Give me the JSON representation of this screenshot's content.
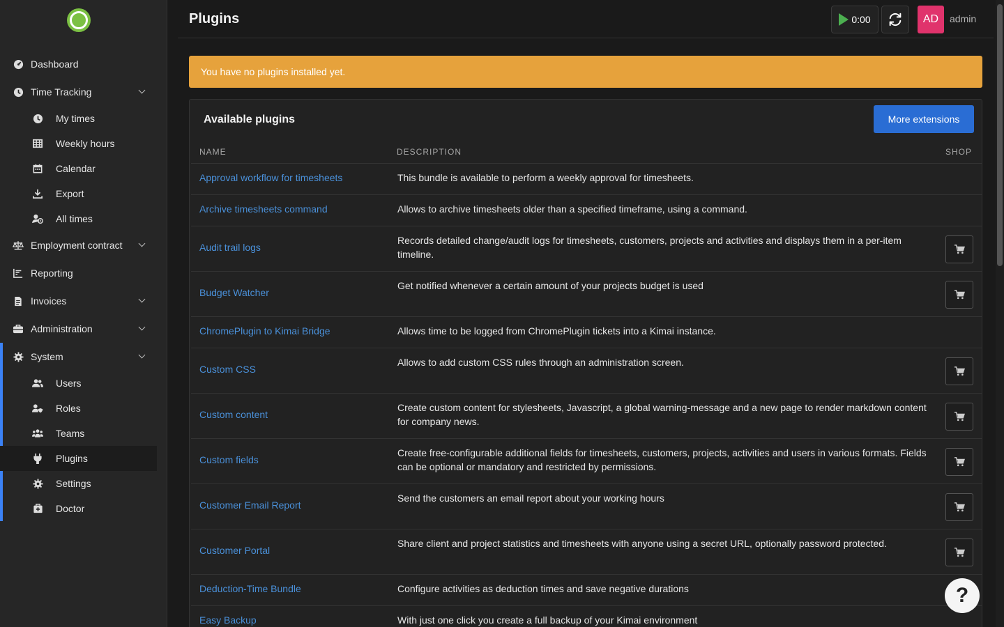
{
  "app": {
    "title": "Plugins",
    "accent": "#2a6dd4"
  },
  "sidebar": {
    "items": [
      {
        "label": "Dashboard",
        "icon": "dashboard-icon"
      },
      {
        "label": "Time Tracking",
        "icon": "clock-icon",
        "expandable": true
      },
      {
        "label": "My times",
        "icon": "clock-icon",
        "sub": true
      },
      {
        "label": "Weekly hours",
        "icon": "table-icon",
        "sub": true
      },
      {
        "label": "Calendar",
        "icon": "calendar-icon",
        "sub": true
      },
      {
        "label": "Export",
        "icon": "download-icon",
        "sub": true
      },
      {
        "label": "All times",
        "icon": "user-clock-icon",
        "sub": true
      },
      {
        "label": "Employment contract",
        "icon": "balance-scale-icon",
        "expandable": true
      },
      {
        "label": "Reporting",
        "icon": "chart-icon"
      },
      {
        "label": "Invoices",
        "icon": "invoice-icon",
        "expandable": true
      },
      {
        "label": "Administration",
        "icon": "toolbox-icon",
        "expandable": true
      },
      {
        "label": "System",
        "icon": "gear-icon",
        "expandable": true
      },
      {
        "label": "Users",
        "icon": "users-icon",
        "sub": true
      },
      {
        "label": "Roles",
        "icon": "user-shield-icon",
        "sub": true
      },
      {
        "label": "Teams",
        "icon": "team-icon",
        "sub": true
      },
      {
        "label": "Plugins",
        "icon": "plug-icon",
        "sub": true,
        "active": true
      },
      {
        "label": "Settings",
        "icon": "gear-icon",
        "sub": true
      },
      {
        "label": "Doctor",
        "icon": "medkit-icon",
        "sub": true
      }
    ]
  },
  "header": {
    "title": "Plugins",
    "timer": "0:00",
    "avatar": "AD",
    "username": "admin"
  },
  "alert": {
    "text": "You have no plugins installed yet."
  },
  "plugins": {
    "title": "Available plugins",
    "more_label": "More extensions",
    "columns": {
      "name": "NAME",
      "description": "DESCRIPTION",
      "shop": "SHOP"
    },
    "rows": [
      {
        "name": "Approval workflow for timesheets",
        "desc": "This bundle is available to perform a weekly approval for timesheets.",
        "shop": false
      },
      {
        "name": "Archive timesheets command",
        "desc": "Allows to archive timesheets older than a specified timeframe, using a command.",
        "shop": false
      },
      {
        "name": "Audit trail logs",
        "desc": "Records detailed change/audit logs for timesheets, customers, projects and activities and displays them in a per-item timeline.",
        "shop": true
      },
      {
        "name": "Budget Watcher",
        "desc": "Get notified whenever a certain amount of your projects budget is used",
        "shop": true
      },
      {
        "name": "ChromePlugin to Kimai Bridge",
        "desc": "Allows time to be logged from ChromePlugin tickets into a Kimai instance.",
        "shop": false
      },
      {
        "name": "Custom CSS",
        "desc": "Allows to add custom CSS rules through an administration screen.",
        "shop": true
      },
      {
        "name": "Custom content",
        "desc": "Create custom content for stylesheets, Javascript, a global warning-message and a new page to render markdown content for company news.",
        "shop": true
      },
      {
        "name": "Custom fields",
        "desc": "Create free-configurable additional fields for timesheets, customers, projects, activities and users in various formats. Fields can be optional or mandatory and restricted by permissions.",
        "shop": true
      },
      {
        "name": "Customer Email Report",
        "desc": "Send the customers an email report about your working hours",
        "shop": true
      },
      {
        "name": "Customer Portal",
        "desc": "Share client and project statistics and timesheets with anyone using a secret URL, optionally password protected.",
        "shop": true
      },
      {
        "name": "Deduction-Time Bundle",
        "desc": "Configure activities as deduction times and save negative durations",
        "shop": false
      },
      {
        "name": "Easy Backup",
        "desc": "With just one click you create a full backup of your Kimai environment",
        "shop": false
      }
    ]
  },
  "help": {
    "label": "?"
  }
}
